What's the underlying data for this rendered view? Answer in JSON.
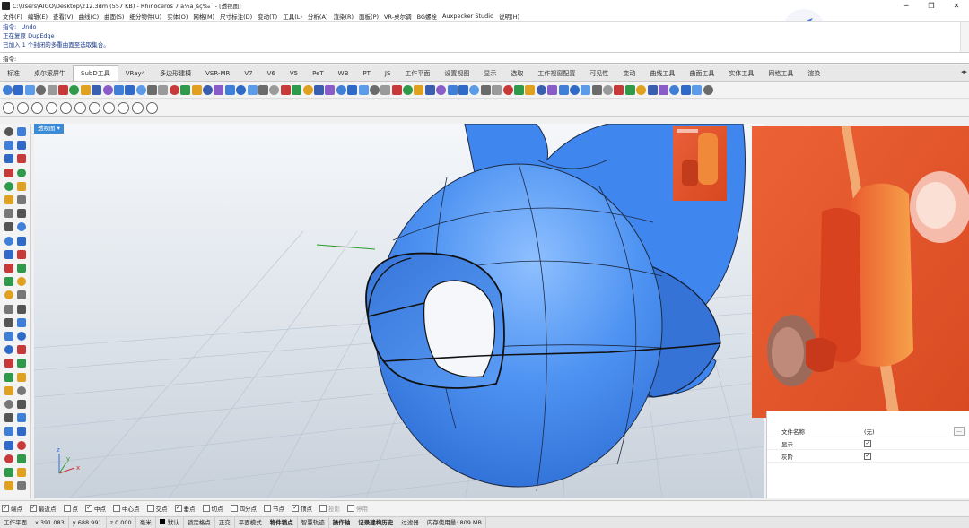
{
  "window": {
    "title": "C:\\Users\\AIGO\\Desktop\\212.3dm (557 KB) - Rhinoceros 7 ä¼ä¸šç‰ˆ - [透视图]",
    "controls": [
      "─",
      "❐",
      "✕"
    ]
  },
  "menu": [
    "文件(F)",
    "编辑(E)",
    "查看(V)",
    "曲线(C)",
    "曲面(S)",
    "细分物件(U)",
    "实体(O)",
    "网格(M)",
    "尺寸标注(D)",
    "变动(T)",
    "工具(L)",
    "分析(A)",
    "渲染(R)",
    "面板(P)",
    "VR-桌尔调",
    "BG螺栓",
    "Auxpecker Studio",
    "说明(H)"
  ],
  "command_history": [
    "指令: _Undo",
    "正在复原 DupEdge",
    "已加入 1 个封闭的多重曲面至选取集合。"
  ],
  "command_prompt": "指令:",
  "tabs": [
    "标准",
    "桌尔滚屏牛",
    "SubD工具",
    "VRay4",
    "多边形建模",
    "VSR-MR",
    "V7",
    "V6",
    "V5",
    "PeT",
    "WB",
    "PT",
    "JS",
    "工作平面",
    "设置视图",
    "显示",
    "选取",
    "工作视窗配置",
    "可见性",
    "变动",
    "曲线工具",
    "曲面工具",
    "实体工具",
    "网格工具",
    "渲染"
  ],
  "active_tab": "SubD工具",
  "viewport": {
    "label": "透视图",
    "axis": {
      "x": "x",
      "y": "y",
      "z": "z"
    }
  },
  "properties": {
    "rows": [
      {
        "label": "文件名称",
        "value": "(无)",
        "more": "..."
      },
      {
        "label": "显示",
        "checked": true
      },
      {
        "label": "灰阶",
        "checked": true
      }
    ]
  },
  "osnaps": [
    {
      "label": "端点",
      "checked": true
    },
    {
      "label": "最近点",
      "checked": true
    },
    {
      "label": "点",
      "checked": false
    },
    {
      "label": "中点",
      "checked": true
    },
    {
      "label": "中心点",
      "checked": false
    },
    {
      "label": "交点",
      "checked": false
    },
    {
      "label": "垂点",
      "checked": true
    },
    {
      "label": "切点",
      "checked": false
    },
    {
      "label": "四分点",
      "checked": false
    },
    {
      "label": "节点",
      "checked": false
    },
    {
      "label": "顶点",
      "checked": true
    },
    {
      "label": "投影",
      "checked": false,
      "disabled": true
    },
    {
      "label": "停用",
      "checked": false,
      "disabled": true
    }
  ],
  "status": {
    "cplane": "工作平面",
    "x": "x 391.083",
    "y": "y 688.991",
    "z": "z 0.000",
    "unit": "毫米",
    "layer": "默认",
    "items": [
      "锁定格点",
      "正交",
      "平面模式",
      "物件锁点",
      "智慧轨迹",
      "操作轴",
      "记录建构历史",
      "过滤器",
      "内存使用量: 809 MB"
    ],
    "bold_items": [
      "物件锁点",
      "操作轴",
      "记录建构历史"
    ]
  },
  "colors": {
    "viewport_label": "#3c8bd6",
    "model_blue": "#3d8af0",
    "photo_bg": "#e4552c"
  }
}
